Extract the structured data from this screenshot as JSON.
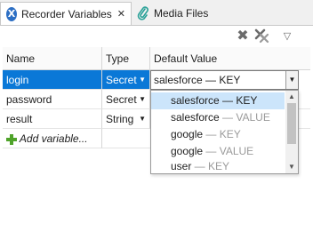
{
  "tabs": [
    {
      "label": "Recorder Variables",
      "icon": "recorder-icon",
      "closable": true
    },
    {
      "label": "Media Files",
      "icon": "paperclip-icon"
    }
  ],
  "toolbar": {
    "remove_icon": "delete-icon",
    "remove_all_icon": "delete-all-icon",
    "menu_icon": "view-menu-chevron-icon"
  },
  "table": {
    "columns": [
      "Name",
      "Type",
      "Default Value"
    ],
    "rows": [
      {
        "name": "login",
        "type": "Secret",
        "value": "salesforce — KEY"
      },
      {
        "name": "password",
        "type": "Secret",
        "value": ""
      },
      {
        "name": "result",
        "type": "String",
        "value": ""
      }
    ],
    "add_label": "Add variable..."
  },
  "dropdown": {
    "options": [
      {
        "value": "salesforce",
        "kind": "KEY"
      },
      {
        "value": "salesforce",
        "kind": "VALUE"
      },
      {
        "value": "google",
        "kind": "KEY"
      },
      {
        "value": "google",
        "kind": "VALUE"
      },
      {
        "value": "user",
        "kind": "KEY"
      }
    ],
    "separator": " — "
  },
  "colors": {
    "selection": "#0a78d7",
    "highlight": "#cce5fb",
    "accent": "#2d6fc4"
  }
}
